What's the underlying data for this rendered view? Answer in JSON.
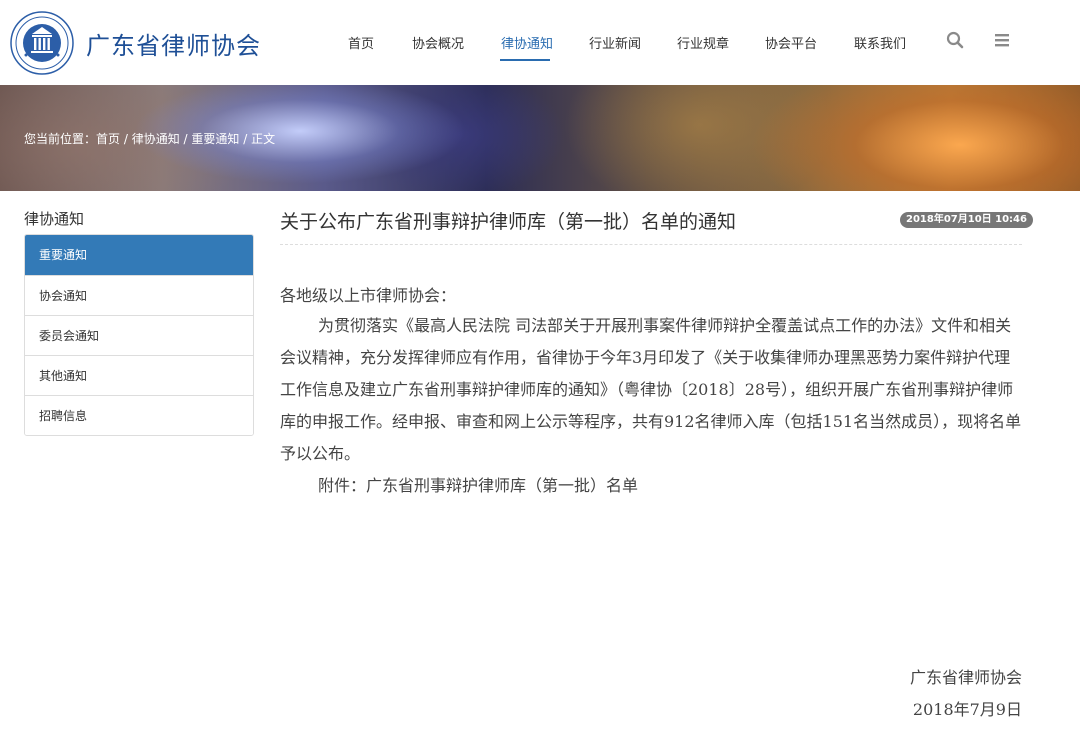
{
  "header": {
    "logo_title": "广东省律师协会",
    "seal_text": "GUANGDONG LAWYERS ASSOCIATION",
    "nav": [
      {
        "label": "首页"
      },
      {
        "label": "协会概况"
      },
      {
        "label": "律协通知",
        "active": true
      },
      {
        "label": "行业新闻"
      },
      {
        "label": "行业规章"
      },
      {
        "label": "协会平台"
      },
      {
        "label": "联系我们"
      }
    ],
    "icons": [
      "search-icon",
      "menu-icon"
    ],
    "accent_color": "#2a6cb0"
  },
  "breadcrumb": {
    "prefix": "您当前位置：",
    "items": [
      "首页",
      "律协通知",
      "重要通知",
      "正文"
    ],
    "separator": " / "
  },
  "sidebar": {
    "title": "律协通知",
    "items": [
      {
        "label": "重要通知",
        "active": true
      },
      {
        "label": "协会通知"
      },
      {
        "label": "委员会通知"
      },
      {
        "label": "其他通知"
      },
      {
        "label": "招聘信息"
      }
    ],
    "active_color": "#337ab7"
  },
  "article": {
    "title": "关于公布广东省刑事辩护律师库（第一批）名单的通知",
    "date": "2018年07月10日 10:46",
    "salutation": "各地级以上市律师协会：",
    "body": "为贯彻落实《最高人民法院 司法部关于开展刑事案件律师辩护全覆盖试点工作的办法》文件和相关会议精神，充分发挥律师应有作用，省律协于今年3月印发了《关于收集律师办理黑恶势力案件辩护代理工作信息及建立广东省刑事辩护律师库的通知》（粤律协〔2018〕28号），组织开展广东省刑事辩护律师库的申报工作。经申报、审查和网上公示等程序，共有912名律师入库（包括151名当然成员），现将名单予以公布。",
    "attachment": "附件：广东省刑事辩护律师库（第一批）名单",
    "signature_org": "广东省律师协会",
    "signature_date": "2018年7月9日"
  }
}
